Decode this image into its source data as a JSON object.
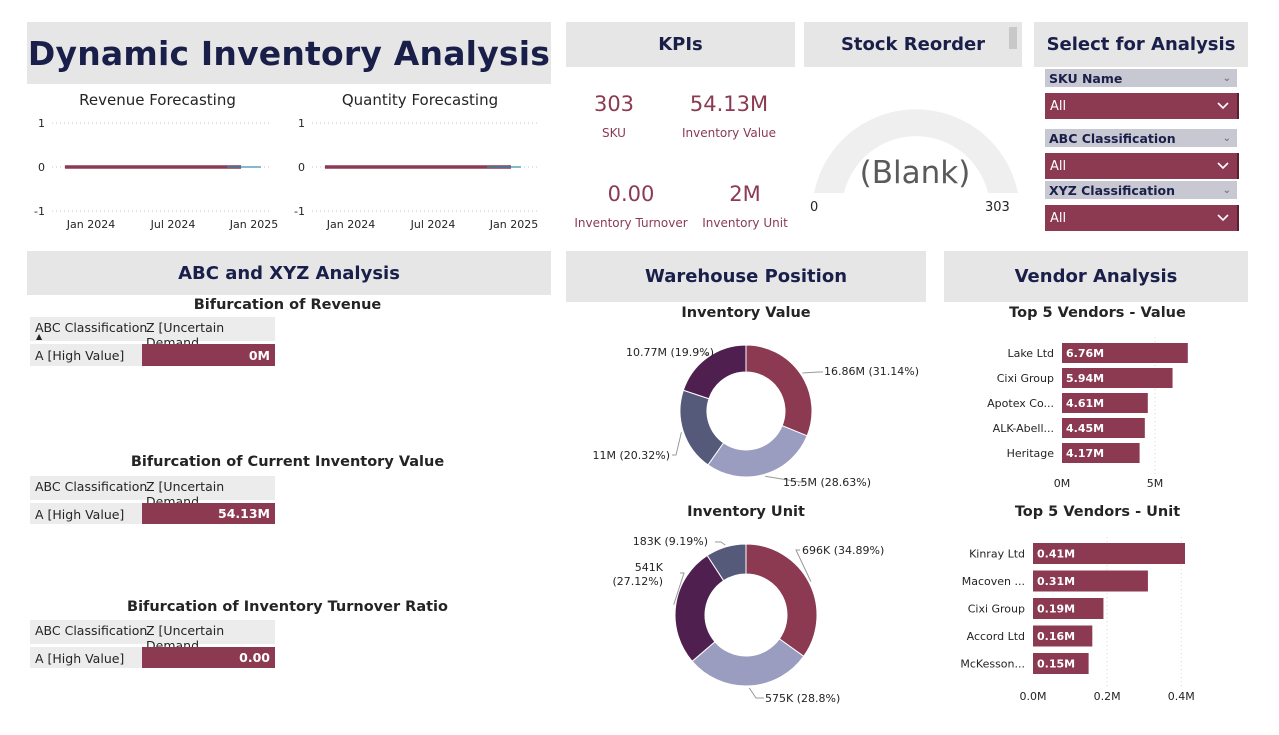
{
  "dashboard": {
    "title": "Dynamic Inventory Analysis"
  },
  "colors": {
    "maroon": "#8b3a52",
    "purple": "#4f1f4f",
    "slate": "#555a7a",
    "lavender": "#9a9cc0",
    "header_bg": "#e6e6e6",
    "navy": "#1a1f4a"
  },
  "forecast": {
    "revenue_title": "Revenue Forecasting",
    "quantity_title": "Quantity Forecasting",
    "y_ticks": [
      "1",
      "0",
      "-1"
    ],
    "x_ticks": [
      "Jan 2024",
      "Jul 2024",
      "Jan 2025"
    ]
  },
  "kpis": {
    "header": "KPIs",
    "items": [
      {
        "value": "303",
        "label": "SKU"
      },
      {
        "value": "54.13M",
        "label": "Inventory Value"
      },
      {
        "value": "0.00",
        "label": "Inventory Turnover"
      },
      {
        "value": "2M",
        "label": "Inventory Unit"
      }
    ]
  },
  "stock_reorder": {
    "header": "Stock Reorder",
    "gauge_value": "(Blank)",
    "gauge_min": "0",
    "gauge_max": "303"
  },
  "slicers": {
    "header": "Select for Analysis",
    "items": [
      {
        "label": "SKU Name",
        "selected": "All"
      },
      {
        "label": "ABC Classification",
        "selected": "All"
      },
      {
        "label": "XYZ Classification",
        "selected": "All"
      }
    ]
  },
  "abc_xyz": {
    "header": "ABC and XYZ Analysis",
    "tables": [
      {
        "title": "Bifurcation of Revenue",
        "col1": "ABC Classification",
        "col2": "Z [Uncertain Demand",
        "row_label": "A [High Value]",
        "row_value": "0M"
      },
      {
        "title": "Bifurcation of Current Inventory Value",
        "col1": "ABC Classification",
        "col2": "Z [Uncertain Demand",
        "row_label": "A [High Value]",
        "row_value": "54.13M"
      },
      {
        "title": "Bifurcation of Inventory Turnover Ratio",
        "col1": "ABC Classification",
        "col2": "Z [Uncertain Demand",
        "row_label": "A [High Value]",
        "row_value": "0.00"
      }
    ]
  },
  "warehouse": {
    "header": "Warehouse Position",
    "value_title": "Inventory Value",
    "unit_title": "Inventory Unit"
  },
  "vendor": {
    "header": "Vendor Analysis",
    "value_title": "Top 5 Vendors - Value",
    "unit_title": "Top 5 Vendors - Unit"
  },
  "chart_data": [
    {
      "type": "line",
      "title": "Revenue Forecasting",
      "x": [
        "Jan 2024",
        "Jul 2024",
        "Jan 2025"
      ],
      "series": [
        {
          "values": [
            0,
            0,
            0
          ]
        }
      ],
      "ylim": [
        -1,
        1
      ]
    },
    {
      "type": "line",
      "title": "Quantity Forecasting",
      "x": [
        "Jan 2024",
        "Jul 2024",
        "Jan 2025"
      ],
      "series": [
        {
          "values": [
            0,
            0,
            0
          ]
        }
      ],
      "ylim": [
        -1,
        1
      ]
    },
    {
      "type": "pie",
      "title": "Inventory Value",
      "slices": [
        {
          "label": "16.86M (31.14%)",
          "value": 31.14,
          "color": "#8b3a52"
        },
        {
          "label": "15.5M (28.63%)",
          "value": 28.63,
          "color": "#9a9cc0"
        },
        {
          "label": "11M (20.32%)",
          "value": 20.32,
          "color": "#555a7a"
        },
        {
          "label": "10.77M (19.9%)",
          "value": 19.9,
          "color": "#4f1f4f"
        }
      ]
    },
    {
      "type": "pie",
      "title": "Inventory Unit",
      "slices": [
        {
          "label": "696K (34.89%)",
          "value": 34.89,
          "color": "#8b3a52"
        },
        {
          "label": "575K (28.8%)",
          "value": 28.8,
          "color": "#9a9cc0"
        },
        {
          "label": "541K (27.12%)",
          "value": 27.12,
          "color": "#4f1f4f"
        },
        {
          "label": "183K (9.19%)",
          "value": 9.19,
          "color": "#555a7a"
        }
      ]
    },
    {
      "type": "bar",
      "title": "Top 5 Vendors - Value",
      "categories": [
        "Lake Ltd",
        "Cixi Group",
        "Apotex Co...",
        "ALK-Abell...",
        "Heritage"
      ],
      "values": [
        6.76,
        5.94,
        4.61,
        4.45,
        4.17
      ],
      "value_labels": [
        "6.76M",
        "5.94M",
        "4.61M",
        "4.45M",
        "4.17M"
      ],
      "x_ticks": [
        0,
        5
      ],
      "x_tick_labels": [
        "0M",
        "5M"
      ],
      "xlim": [
        0,
        7.2
      ]
    },
    {
      "type": "bar",
      "title": "Top 5 Vendors - Unit",
      "categories": [
        "Kinray Ltd",
        "Macoven ...",
        "Cixi Group",
        "Accord Ltd",
        "McKesson..."
      ],
      "values": [
        0.41,
        0.31,
        0.19,
        0.16,
        0.15
      ],
      "value_labels": [
        "0.41M",
        "0.31M",
        "0.19M",
        "0.16M",
        "0.15M"
      ],
      "x_ticks": [
        0,
        0.2,
        0.4
      ],
      "x_tick_labels": [
        "0.0M",
        "0.2M",
        "0.4M"
      ],
      "xlim": [
        0,
        0.41
      ]
    }
  ]
}
